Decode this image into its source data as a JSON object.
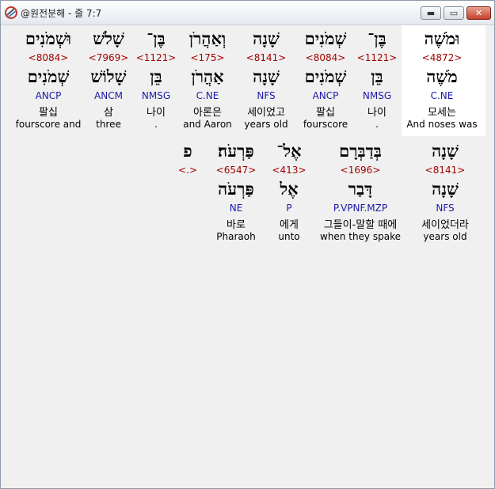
{
  "window": {
    "title": "@원전분해 - 줄 7:7",
    "buttons": {
      "minimize": "▬",
      "maximize": "▭",
      "close": "✕"
    }
  },
  "rows": [
    [
      {
        "heb": "וּמֹשֶׁה",
        "strong": "<4872>",
        "lemma": "מֹשֶׁה",
        "morph": "C.NE",
        "kor": "모세는",
        "eng": "And noses was",
        "highlight": true
      },
      {
        "heb": "בֶּן־",
        "strong": "<1121>",
        "lemma": "בֵּן",
        "morph": "NMSG",
        "kor": "나이",
        "eng": "."
      },
      {
        "heb": "שְׁמֹנִים",
        "strong": "<8084>",
        "lemma": "שְׁמֹנִים",
        "morph": "ANCP",
        "kor": "팔십",
        "eng": "fourscore"
      },
      {
        "heb": "שָׁנָה",
        "strong": "<8141>",
        "lemma": "שָׁנָה",
        "morph": "NFS",
        "kor": "세이었고",
        "eng": "years old"
      },
      {
        "heb": "וְאַהֲרֹן",
        "strong": "<175>",
        "lemma": "אַהֲרֹן",
        "morph": "C.NE",
        "kor": "아론은",
        "eng": "and Aaron"
      },
      {
        "heb": "בֶּן־",
        "strong": "<1121>",
        "lemma": "בֵּן",
        "morph": "NMSG",
        "kor": "나이",
        "eng": "."
      },
      {
        "heb": "שָׁלֹשׁ",
        "strong": "<7969>",
        "lemma": "שָׁלוֹשׁ",
        "morph": "ANCM",
        "kor": "삼",
        "eng": "three"
      },
      {
        "heb": "וּשְׁמֹנִים",
        "strong": "<8084>",
        "lemma": "שְׁמֹנִים",
        "morph": "ANCP",
        "kor": "팔십",
        "eng": "fourscore and"
      }
    ],
    [
      {
        "heb": "שָׁנָה",
        "strong": "<8141>",
        "lemma": "שָׁנָה",
        "morph": "NFS",
        "kor": "세이었더라",
        "eng": "years old"
      },
      {
        "heb": "בְּדַבְּרָם",
        "strong": "<1696>",
        "lemma": "דָּבַר",
        "morph": "P.VPNF.MZP",
        "kor": "그들이-말할 때에",
        "eng": "when they spake"
      },
      {
        "heb": "אֶל־",
        "strong": "<413>",
        "lemma": "אֶל",
        "morph": "P",
        "kor": "에게",
        "eng": "unto"
      },
      {
        "heb": "פַּרְעֹה׃",
        "strong": "<6547>",
        "lemma": "פַּרְעֹה",
        "morph": "NE",
        "kor": "바로",
        "eng": "Pharaoh"
      },
      {
        "heb": "פ",
        "strong": "<.>",
        "lemma": "",
        "morph": "",
        "kor": "",
        "eng": ""
      }
    ]
  ]
}
